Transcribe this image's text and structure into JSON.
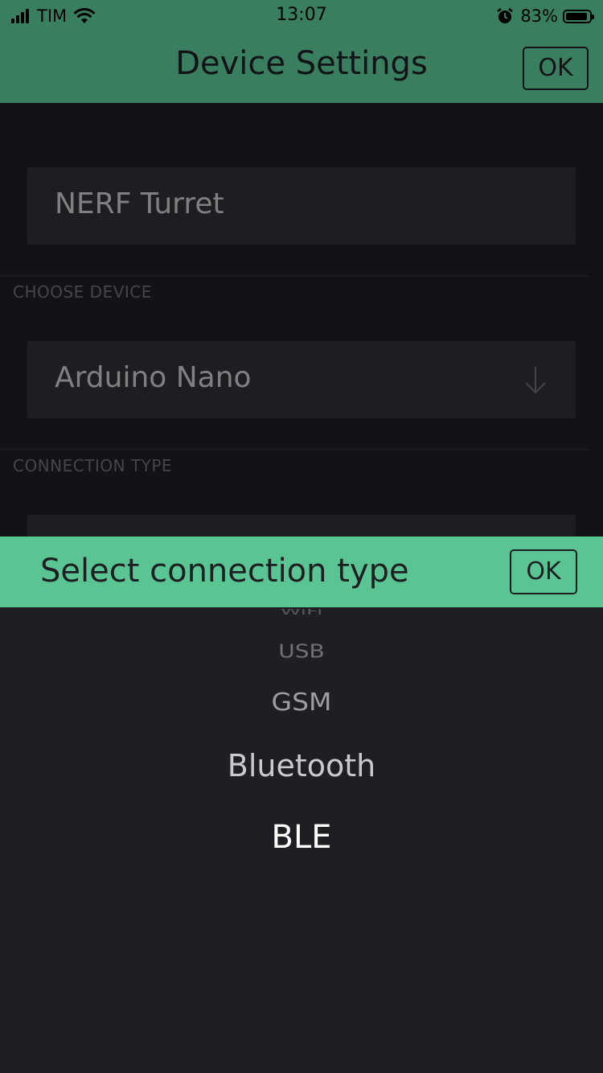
{
  "status_bar": {
    "carrier": "TIM",
    "time": "13:07",
    "battery": "83%",
    "battery_level": 0.83
  },
  "nav": {
    "title": "Device Settings",
    "ok_label": "OK"
  },
  "form": {
    "project_name": "NERF Turret",
    "device_label": "CHOOSE DEVICE",
    "device_value": "Arduino Nano",
    "connection_label": "CONNECTION TYPE"
  },
  "picker": {
    "title": "Select connection type",
    "ok_label": "OK",
    "options": [
      "WiFi",
      "USB",
      "GSM",
      "Bluetooth",
      "BLE"
    ],
    "selected": "BLE"
  },
  "colors": {
    "accent": "#5ac593",
    "background": "#1d1f23",
    "field": "#2c2f34"
  },
  "icons": [
    "signal-icon",
    "wifi-icon",
    "alarm-icon",
    "battery-icon",
    "arrow-down-icon"
  ]
}
